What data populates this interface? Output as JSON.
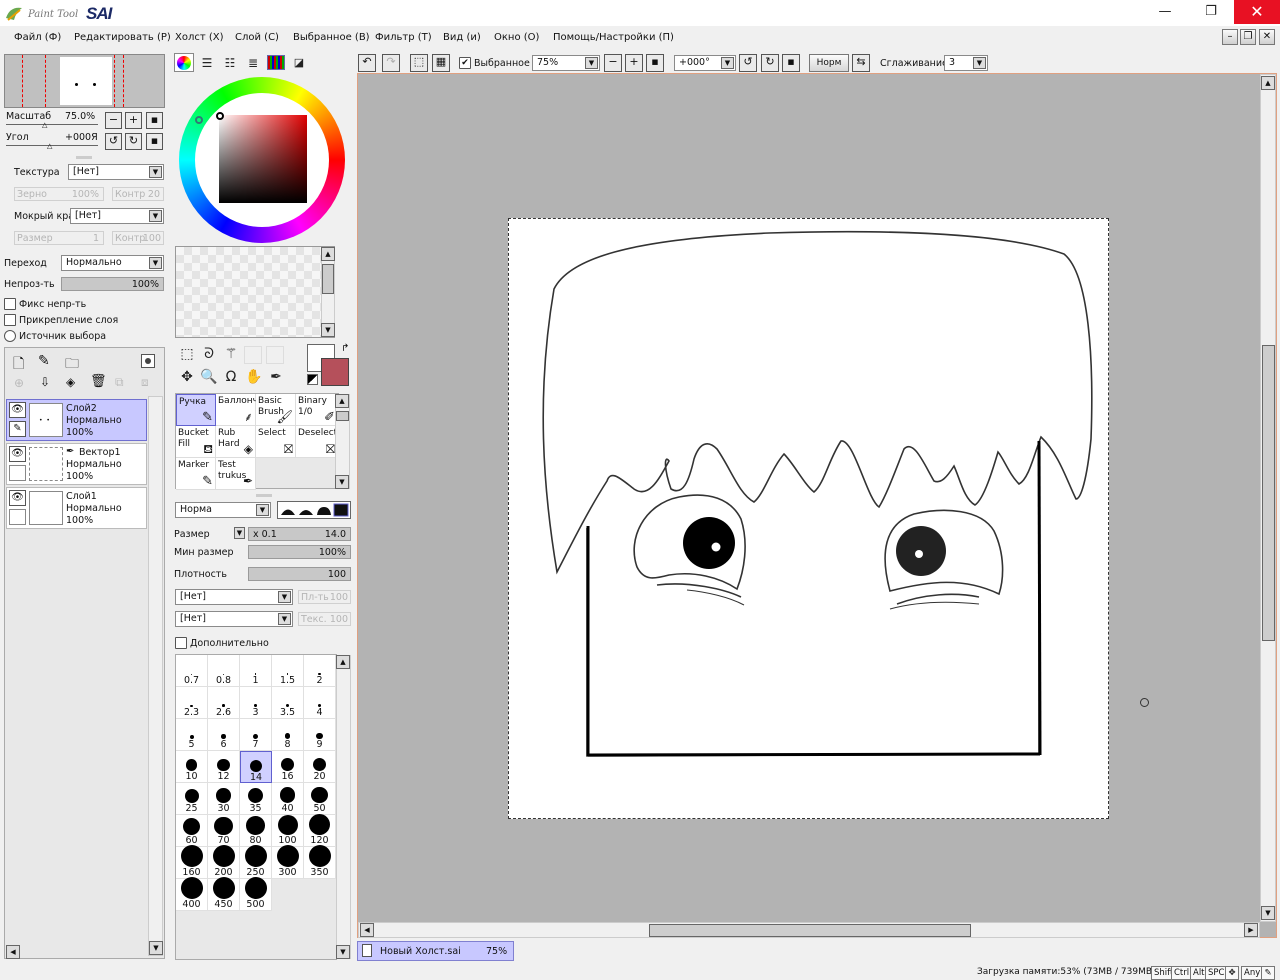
{
  "app": {
    "logo_sub": "Paint Tool",
    "logo_main": "SAI",
    "min": "—",
    "max": "❐",
    "close": "✕"
  },
  "menu": [
    "Файл (Ф)",
    "Редактировать (Р)",
    "Холст (Х)",
    "Слой (С)",
    "Выбранное (В)",
    "Фильтр (Т)",
    "Вид (и)",
    "Окно (О)",
    "Помощь/Настройки (П)"
  ],
  "nav": {
    "scale_label": "Масштаб",
    "scale_value": "75.0%",
    "angle_label": "Угол",
    "angle_value": "+000Я"
  },
  "texture": {
    "label": "Текстура",
    "value": "[Нет]",
    "grain_label": "Зерно",
    "grain_value": "100%",
    "contrast_label": "Контр",
    "contrast_value": "20"
  },
  "wet": {
    "label": "Мокрый край",
    "value": "[Нет]",
    "size_label": "Размер",
    "size_value": "1",
    "contrast_label": "Контр",
    "contrast_value": "100"
  },
  "blend": {
    "label": "Переход",
    "value": "Нормально",
    "opacity_label": "Непроз-ть",
    "opacity_value": "100%"
  },
  "checks": {
    "fix": "Фикс непр-ть",
    "clip": "Прикрепление слоя",
    "source": "Источник выбора"
  },
  "layers": [
    {
      "name": "Слой2",
      "mode": "Нормально",
      "opacity": "100%"
    },
    {
      "name": "Вектор1",
      "mode": "Нормально",
      "opacity": "100%"
    },
    {
      "name": "Слой1",
      "mode": "Нормально",
      "opacity": "100%"
    }
  ],
  "tools": [
    {
      "l1": "Ручка",
      "l2": ""
    },
    {
      "l1": "Баллонч",
      "l2": ""
    },
    {
      "l1": "Basic",
      "l2": "Brush"
    },
    {
      "l1": "Binary",
      "l2": "1/0"
    },
    {
      "l1": "Bucket",
      "l2": "Fill"
    },
    {
      "l1": "Rub",
      "l2": "Hard"
    },
    {
      "l1": "Select",
      "l2": ""
    },
    {
      "l1": "Deselect",
      "l2": ""
    },
    {
      "l1": "Marker",
      "l2": ""
    },
    {
      "l1": "Test",
      "l2": "trukus"
    }
  ],
  "brush": {
    "mode": "Норма",
    "size_label": "Размер",
    "size_mult": "x 0.1",
    "size_value": "14.0",
    "minsize_label": "Мин размер",
    "minsize_value": "100%",
    "density_label": "Плотность",
    "density_value": "100",
    "shape_value": "[Нет]",
    "shape_grain_label": "Пл-ть",
    "shape_grain_value": "100",
    "tex_value": "[Нет]",
    "tex_label": "Текс.",
    "tex_value2": "100",
    "advanced": "Дополнительно"
  },
  "sizes": [
    "0.7",
    "0.8",
    "1",
    "1.5",
    "2",
    "2.3",
    "2.6",
    "3",
    "3.5",
    "4",
    "5",
    "6",
    "7",
    "8",
    "9",
    "10",
    "12",
    "14",
    "16",
    "20",
    "25",
    "30",
    "35",
    "40",
    "50",
    "60",
    "70",
    "80",
    "100",
    "120",
    "160",
    "200",
    "250",
    "300",
    "350",
    "400",
    "450",
    "500"
  ],
  "toolbar": {
    "selection_label": "Выбранное",
    "zoom": "75%",
    "angle": "+000°",
    "norm": "Норм",
    "smooth_label": "Сглаживание",
    "smooth_value": "3"
  },
  "tab": {
    "name": "Новый Холст.sai",
    "zoom": "75%"
  },
  "status": {
    "memory": "Загрузка памяти:53% (73MB / 739MB)",
    "keys": [
      "Shift",
      "Ctrl",
      "Alt",
      "SPC"
    ],
    "any": "Any"
  },
  "colors": {
    "primary": "#ffffff",
    "secondary": "#b5505b",
    "selection": "#c8c8ff",
    "canvas_bg": "#b3b3b3"
  }
}
